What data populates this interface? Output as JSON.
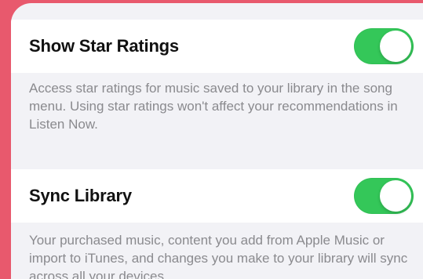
{
  "settings": {
    "star_ratings": {
      "label": "Show Star Ratings",
      "enabled": true,
      "footnote": "Access star ratings for music saved to your library in the song menu. Using star ratings won't affect your recommendations in Listen Now."
    },
    "sync_library": {
      "label": "Sync Library",
      "enabled": true,
      "footnote": "Your purchased music, content you add from Apple Music or import to iTunes, and changes you make to your library will sync across all your devices."
    }
  },
  "colors": {
    "toggle_on": "#34c759",
    "frame_background": "#e8596d",
    "grouped_background": "#f2f2f6",
    "footnote_text": "#8a8a8e"
  }
}
